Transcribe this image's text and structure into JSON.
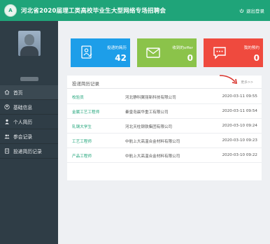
{
  "header": {
    "title": "河北省2020届理工类高校毕业生大型网络专场招聘会",
    "logo_text": "A",
    "logout_label": "退出登录"
  },
  "sidebar": {
    "items": [
      {
        "label": "首页",
        "icon": "home-icon"
      },
      {
        "label": "基础信息",
        "icon": "user-circle-icon"
      },
      {
        "label": "个人简历",
        "icon": "person-icon"
      },
      {
        "label": "参会记录",
        "icon": "people-icon"
      },
      {
        "label": "投递简历记录",
        "icon": "document-icon"
      }
    ]
  },
  "stats": [
    {
      "label": "投递的简历",
      "value": "42",
      "color": "#1d9ee9",
      "icon": "resume-icon"
    },
    {
      "label": "收到的offer",
      "value": "0",
      "color": "#8bc34a",
      "icon": "mail-icon"
    },
    {
      "label": "我的预约",
      "value": "0",
      "color": "#ef4a3e",
      "icon": "chat-icon"
    }
  ],
  "records": {
    "title": "投递简历记录",
    "more_label": "更多>>",
    "rows": [
      {
        "position": "校验员",
        "company": "河北静科翼丽新科技有限公司",
        "date": "2020-03-11 09:55"
      },
      {
        "position": "金属工艺工程师",
        "company": "秦皇岛晨华重工有限公司",
        "date": "2020-03-11 09:54"
      },
      {
        "position": "轧钢大学生",
        "company": "河北天柱钢铁集团有限公司",
        "date": "2020-03-10 09:24"
      },
      {
        "position": "工艺工程师",
        "company": "中航上大高温合金材料有限公司",
        "date": "2020-03-10 09:23"
      },
      {
        "position": "产品工程师",
        "company": "中航上大高温合金材料有限公司",
        "date": "2020-03-10 09:22"
      }
    ]
  }
}
